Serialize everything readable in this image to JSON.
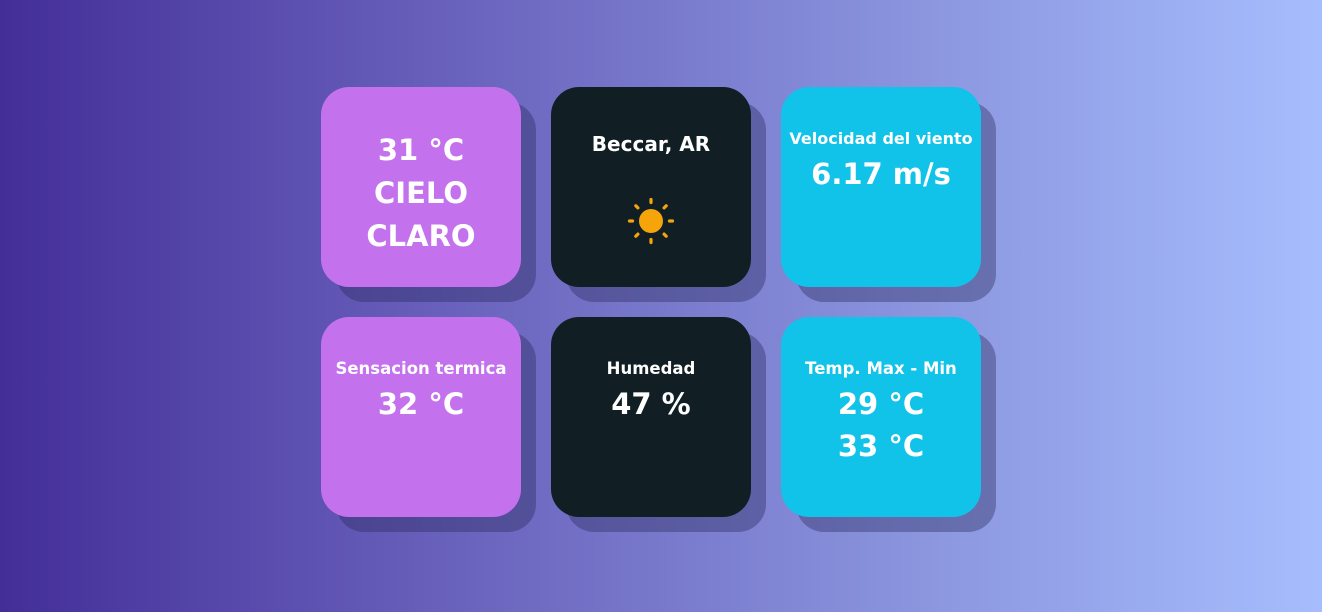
{
  "cards": {
    "main": {
      "temperature": "31 °C",
      "description_line1": "CIELO",
      "description_line2": "CLARO"
    },
    "location": {
      "name": "Beccar, AR",
      "icon": "sun-icon",
      "icon_color": "#f5a40a"
    },
    "wind": {
      "label": "Velocidad del viento",
      "value": "6.17 m/s"
    },
    "feels_like": {
      "label": "Sensacion termica",
      "value": "32 °C"
    },
    "humidity": {
      "label": "Humedad",
      "value": "47 %"
    },
    "minmax": {
      "label": "Temp. Max - Min",
      "max": "29 °C",
      "min": "33 °C"
    }
  },
  "colors": {
    "purple_card": "#c471ed",
    "dark_card": "#111f25",
    "cyan_card": "#11c2e9",
    "background_start": "#432e98",
    "background_end": "#a6bdfd"
  }
}
